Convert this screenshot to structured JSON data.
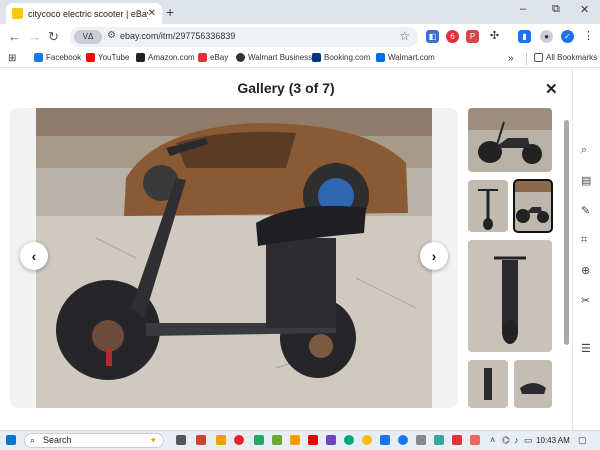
{
  "browser": {
    "tab_title": "citycoco electric scooter | eBay",
    "tab_close": "✕",
    "new_tab": "+",
    "window_controls": {
      "minimize": "–",
      "restore": "⧉",
      "close": "✕"
    },
    "nav": {
      "back": "←",
      "forward": "→",
      "reload": "↻"
    },
    "chip_label": "VΔ",
    "url": "ebay.com/itm/297756336839",
    "ext_count": "6"
  },
  "bookmarks": {
    "items": [
      {
        "label": "Facebook",
        "icon": "facebook-icon",
        "color": "#1877f2"
      },
      {
        "label": "YouTube",
        "icon": "youtube-icon",
        "color": "#ff0000"
      },
      {
        "label": "Amazon.com",
        "icon": "amazon-icon",
        "color": "#222222"
      },
      {
        "label": "eBay",
        "icon": "ebay-icon",
        "color": "#e53238"
      },
      {
        "label": "Walmart Business",
        "icon": "walmart-business-icon",
        "color": "#333333"
      },
      {
        "label": "Booking.com",
        "icon": "booking-icon",
        "color": "#003580"
      },
      {
        "label": "Walmart.com",
        "icon": "walmart-icon",
        "color": "#0071dc"
      }
    ],
    "overflow": "»",
    "all_bookmarks": "All Bookmarks"
  },
  "gallery": {
    "title": "Gallery (3 of 7)",
    "close": "✕",
    "prev": "‹",
    "next": "›",
    "selected_index": 3,
    "thumbnails": [
      "thumbnail-1",
      "thumbnail-2",
      "thumbnail-3",
      "thumbnail-4",
      "thumbnail-5",
      "thumbnail-6"
    ]
  },
  "taskbar": {
    "search_placeholder": "Search",
    "time": "10:43 AM"
  },
  "colors": {
    "accent": "#1a73e8",
    "tab_bg": "#dfe3ea",
    "stage_bg": "#f2f2f2"
  }
}
